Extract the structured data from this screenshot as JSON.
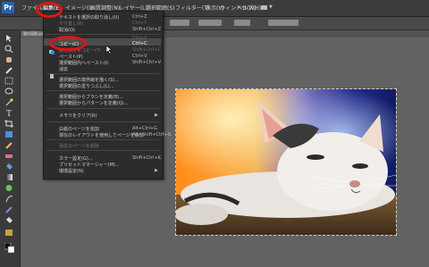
{
  "menubar": {
    "items": [
      "ファイル",
      "編集(E)",
      "イメージ(I)",
      "画質調整(N)",
      "レイヤー(L)",
      "選択範囲(S)",
      "フィルター(T)",
      "表示(V)",
      "ウィンドウ(W)",
      "ヘルプ(H)"
    ]
  },
  "edit_menu": {
    "items": [
      {
        "label": "テキストを選択の取り消し(U)",
        "shortcut": "Ctrl+Z",
        "disabled": false
      },
      {
        "label": "やり直し(R)",
        "shortcut": "Ctrl+Y",
        "disabled": true
      },
      {
        "label": "取消(O)",
        "shortcut": "Shift+Ctrl+Z",
        "disabled": false
      },
      {
        "label": "カット(T)",
        "shortcut": "Ctrl+X",
        "disabled": true
      },
      {
        "label": "コピー(C)",
        "shortcut": "Ctrl+C",
        "disabled": false
      },
      {
        "label": "結合部分をコピー(Y)",
        "shortcut": "Shift+Ctrl+C",
        "disabled": true
      },
      {
        "label": "ペースト(P)",
        "shortcut": "Ctrl+V",
        "disabled": false
      },
      {
        "label": "選択範囲内へペースト(I)",
        "shortcut": "Shift+Ctrl+V",
        "disabled": false
      },
      {
        "label": "消去",
        "shortcut": "",
        "disabled": false
      },
      {
        "label": "選択範囲の境界線を描く(S)...",
        "shortcut": "",
        "disabled": false
      },
      {
        "label": "選択範囲の塗りつぶし(L)...",
        "shortcut": "",
        "disabled": false
      },
      {
        "label": "選択範囲からブラシを定義(B)...",
        "shortcut": "",
        "disabled": false
      },
      {
        "label": "選択範囲からパターンを定義(Q)...",
        "shortcut": "",
        "disabled": false
      },
      {
        "label": "メモリをクリア(R)",
        "shortcut": "",
        "disabled": false
      },
      {
        "label": "白紙のページを追加",
        "shortcut": "Alt+Ctrl+G",
        "disabled": false
      },
      {
        "label": "現在のレイアウトを使用してページを追加",
        "shortcut": "Alt+Shift+Ctrl+G",
        "disabled": false
      },
      {
        "label": "現在のページを削除",
        "shortcut": "",
        "disabled": true
      },
      {
        "label": "カラー設定(G)...",
        "shortcut": "Shift+Ctrl+K",
        "disabled": false
      },
      {
        "label": "プリセットマネージャー(M)...",
        "shortcut": "",
        "disabled": false
      },
      {
        "label": "環境設定(N)",
        "shortcut": "",
        "disabled": false
      }
    ]
  },
  "document": {
    "tab_label": "猫の画像.jpg"
  },
  "colors": {
    "annotation": "#e01414",
    "menubar": "#3b3b3b",
    "menu_bg": "#2c2c2c",
    "canvas": "#626262"
  },
  "icons": [
    "app-logo-icon",
    "move-icon",
    "zoom-icon",
    "hand-icon",
    "eyedropper-icon",
    "marquee-icon",
    "lasso-icon",
    "magic-wand-icon",
    "crop-icon",
    "brush-icon",
    "eraser-icon",
    "type-icon",
    "shape-icon",
    "paint-bucket-icon",
    "gradient-icon",
    "color-swatch-icon",
    "mouse-cursor-icon"
  ]
}
